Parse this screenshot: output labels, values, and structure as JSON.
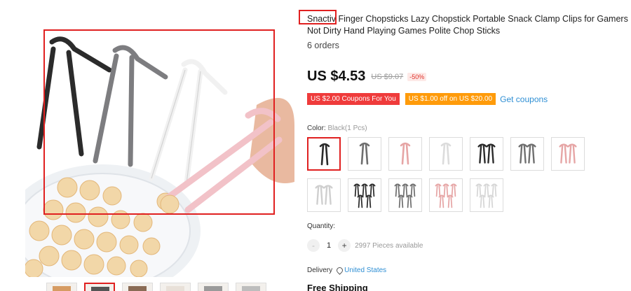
{
  "product": {
    "title": "Snactiv Finger Chopsticks Lazy Chopstick Portable Snack Clamp Clips for Gamers Not Dirty Hand Playing Games Polite Chop Sticks",
    "orders": "6 orders",
    "price": "US $4.53",
    "old_price": "US $9.07",
    "discount": "-50%"
  },
  "coupons": {
    "coupon_1": "US $2.00 Coupons For You",
    "coupon_2": "US $1.00 off on US $20.00",
    "get_coupons": "Get coupons"
  },
  "color": {
    "label": "Color: ",
    "selected": "Black(1 Pcs)",
    "options": [
      {
        "name": "black-1pcs",
        "color": "#2a2a2a",
        "count": 1
      },
      {
        "name": "gray-1pcs",
        "color": "#6f6f6f",
        "count": 1
      },
      {
        "name": "pink-1pcs",
        "color": "#e6a5a5",
        "count": 1
      },
      {
        "name": "white-1pcs",
        "color": "#dcdcdc",
        "count": 1
      },
      {
        "name": "black-2pcs",
        "color": "#2a2a2a",
        "count": 2
      },
      {
        "name": "gray-2pcs",
        "color": "#6f6f6f",
        "count": 2
      },
      {
        "name": "pink-2pcs",
        "color": "#e6a5a5",
        "count": 2
      },
      {
        "name": "white-2pcs",
        "color": "#cfcfcf",
        "count": 2
      },
      {
        "name": "black-5pcs",
        "color": "#2a2a2a",
        "count": 5
      },
      {
        "name": "gray-5pcs",
        "color": "#6f6f6f",
        "count": 5
      },
      {
        "name": "pink-5pcs",
        "color": "#e6a5a5",
        "count": 5
      },
      {
        "name": "white-5pcs",
        "color": "#d6d6d6",
        "count": 5
      }
    ]
  },
  "quantity": {
    "label": "Quantity:",
    "minus": "-",
    "value": "1",
    "plus": "+",
    "available": "2997 Pieces available"
  },
  "delivery": {
    "label": "Delivery",
    "destination": "United States"
  },
  "shipping": {
    "label": "Free Shipping"
  },
  "thumbnails": [
    "thumb-1",
    "thumb-2",
    "thumb-3",
    "thumb-4",
    "thumb-5",
    "thumb-6"
  ],
  "colors": {
    "price_text": "#111111",
    "coupon_red": "#ef3b3b",
    "coupon_orange": "#ff9b0a",
    "link_blue": "#2f8fd4",
    "highlight_red": "#e02020"
  }
}
